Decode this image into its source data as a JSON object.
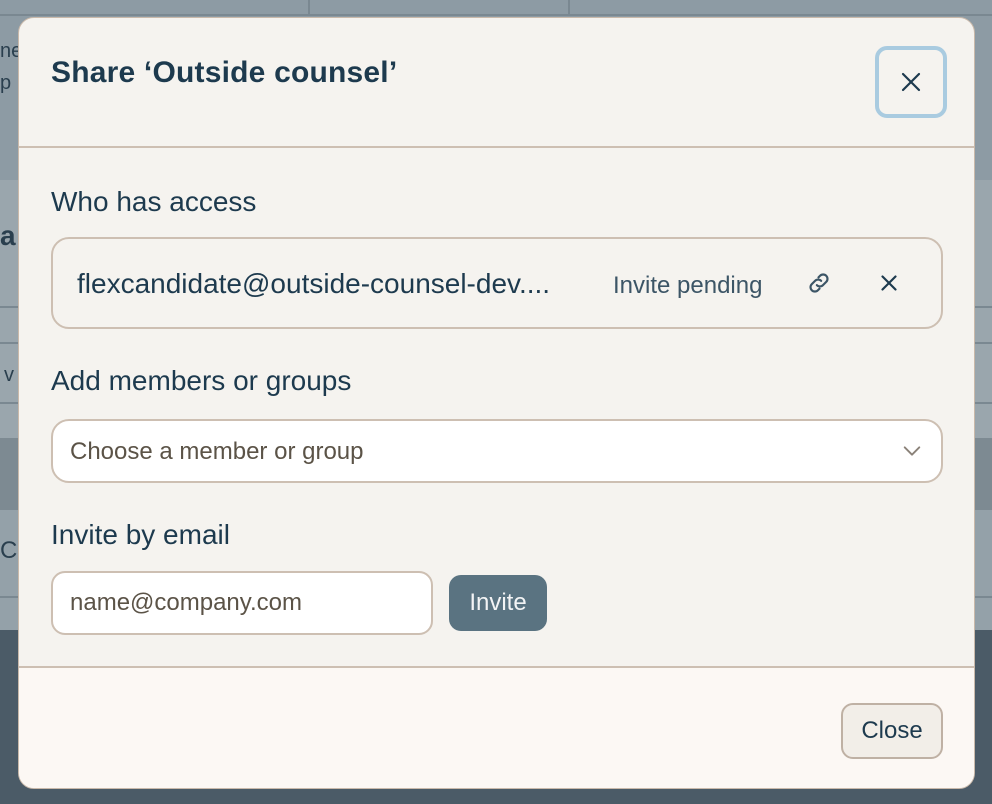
{
  "background": {
    "glyphs": [
      "ne",
      "p",
      "a",
      "v",
      "C"
    ]
  },
  "dialog": {
    "title": "Share ‘Outside counsel’",
    "close_icon": "close-icon",
    "access": {
      "heading": "Who has access",
      "entries": [
        {
          "email": "flexcandidate@outside-counsel-dev....",
          "status": "Invite pending",
          "copy_link_icon": "link-icon",
          "remove_icon": "close-icon"
        }
      ]
    },
    "add_members": {
      "heading": "Add members or groups",
      "select_placeholder": "Choose a member or group",
      "chevron_icon": "chevron-down-icon"
    },
    "invite": {
      "heading": "Invite by email",
      "input_placeholder": "name@company.com",
      "input_value": "",
      "button_label": "Invite"
    },
    "footer": {
      "close_label": "Close"
    }
  },
  "colors": {
    "title_text": "#1d3a4e",
    "invite_button": "#5a7381",
    "focus_ring": "#a9cbe0",
    "border": "#cdbfb2",
    "dialog_bg": "#f5f3ef"
  }
}
